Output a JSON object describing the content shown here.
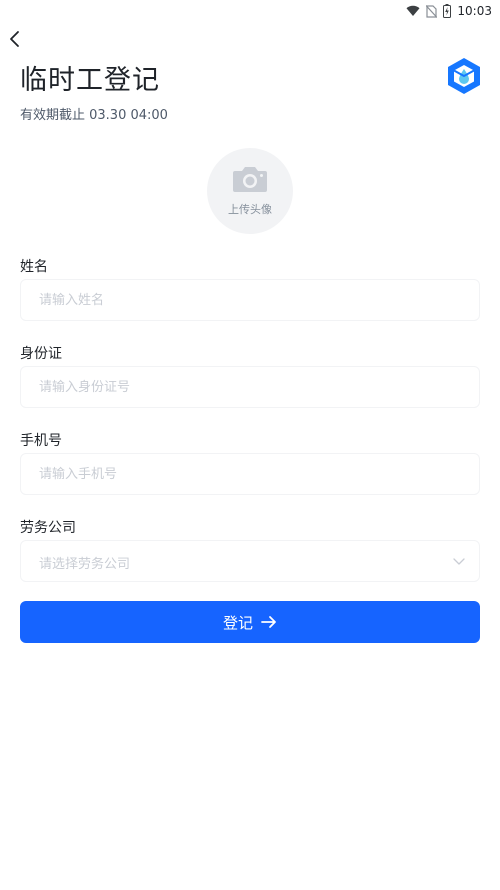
{
  "status_bar": {
    "time": "10:03",
    "icons": [
      "wifi-icon",
      "no-sim-icon",
      "battery-charging-icon"
    ]
  },
  "header": {
    "back_icon": "chevron-left-icon",
    "title": "临时工登记",
    "validity": "有效期截止 03.30 04:00",
    "logo_icon": "hexagon-droplet-logo"
  },
  "avatar": {
    "icon": "camera-icon",
    "label": "上传头像"
  },
  "form": {
    "name": {
      "label": "姓名",
      "placeholder": "请输入姓名",
      "value": ""
    },
    "id_card": {
      "label": "身份证",
      "placeholder": "请输入身份证号",
      "value": ""
    },
    "phone": {
      "label": "手机号",
      "placeholder": "请输入手机号",
      "value": ""
    },
    "company": {
      "label": "劳务公司",
      "placeholder": "请选择劳务公司",
      "icon": "chevron-down-icon"
    }
  },
  "submit": {
    "label": "登记",
    "icon": "arrow-right-icon"
  },
  "colors": {
    "primary": "#1664ff",
    "logo_blue": "#1677ff",
    "logo_accent": "#5ec8f0",
    "placeholder": "#c9cdd4",
    "avatar_bg": "#f2f3f5"
  }
}
